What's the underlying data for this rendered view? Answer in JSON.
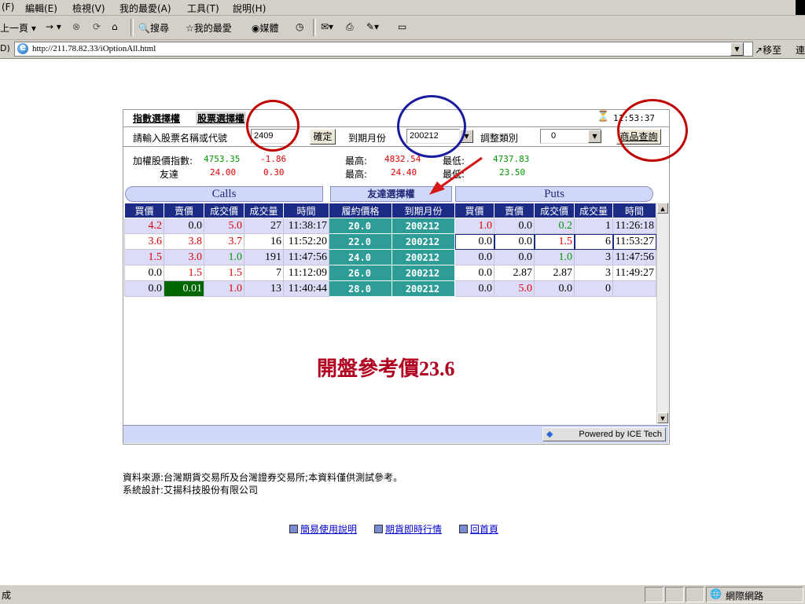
{
  "browser": {
    "menu": [
      "(F)",
      "編輯(E)",
      "檢視(V)",
      "我的最愛(A)",
      "工具(T)",
      "說明(H)"
    ],
    "toolbar": {
      "back": "上一頁",
      "search": "搜尋",
      "favorites": "我的最愛",
      "media": "媒體"
    },
    "address_label": "D)",
    "url": "http://211.78.82.33/iOptionAll.html",
    "go_label": "移至",
    "links_label": "連",
    "status_text": "成",
    "zone_label": "網際網路"
  },
  "widget": {
    "tabs": [
      "指數選擇權",
      "股票選擇權"
    ],
    "clock": "11:53:37",
    "query": {
      "label": "請輸入股票名稱或代號",
      "value": "2409",
      "confirm_button": "確定",
      "month_label": "到期月份",
      "month_value": "200212",
      "adjust_label": "調整類別",
      "adjust_value": "0",
      "lookup_button": "商品查詢"
    },
    "index_row": {
      "label": "加權股價指數:",
      "last": "4753.35",
      "change": "-1.86",
      "high_label": "最高:",
      "high": "4832.54",
      "low_label": "最低:",
      "low": "4737.83"
    },
    "stock_row": {
      "label": "友達",
      "last": "24.00",
      "change": "0.30",
      "high_label": "最高:",
      "high": "24.40",
      "low_label": "最低:",
      "low": "23.50"
    },
    "calls_title": "Calls",
    "center_title": "友達選擇權",
    "puts_title": "Puts",
    "columns": [
      "買價",
      "賣價",
      "成交價",
      "成交量",
      "時間",
      "履約價格",
      "到期月份",
      "買價",
      "賣價",
      "成交價",
      "成交量",
      "時間"
    ],
    "rows": [
      {
        "c_bid": "4.2",
        "c_ask": "0.0",
        "c_last": "5.0",
        "c_vol": "27",
        "c_time": "11:38:17",
        "strike": "20.0",
        "month": "200212",
        "p_bid": "1.0",
        "p_ask": "0.0",
        "p_last": "0.2",
        "p_vol": "1",
        "p_time": "11:26:18"
      },
      {
        "c_bid": "3.6",
        "c_ask": "3.8",
        "c_last": "3.7",
        "c_vol": "16",
        "c_time": "11:52:20",
        "strike": "22.0",
        "month": "200212",
        "p_bid": "0.0",
        "p_ask": "0.0",
        "p_last": "1.5",
        "p_vol": "6",
        "p_time": "11:53:27"
      },
      {
        "c_bid": "1.5",
        "c_ask": "3.0",
        "c_last": "1.0",
        "c_vol": "191",
        "c_time": "11:47:56",
        "strike": "24.0",
        "month": "200212",
        "p_bid": "0.0",
        "p_ask": "0.0",
        "p_last": "1.0",
        "p_vol": "3",
        "p_time": "11:47:56"
      },
      {
        "c_bid": "0.0",
        "c_ask": "1.5",
        "c_last": "1.5",
        "c_vol": "7",
        "c_time": "11:12:09",
        "strike": "26.0",
        "month": "200212",
        "p_bid": "0.0",
        "p_ask": "2.87",
        "p_last": "2.87",
        "p_vol": "3",
        "p_time": "11:49:27"
      },
      {
        "c_bid": "0.0",
        "c_ask": "0.01",
        "c_last": "1.0",
        "c_vol": "13",
        "c_time": "11:40:44",
        "strike": "28.0",
        "month": "200212",
        "p_bid": "0.0",
        "p_ask": "5.0",
        "p_last": "0.0",
        "p_vol": "0",
        "p_time": ""
      }
    ],
    "annotation": "開盤參考價23.6",
    "powered": "Powered by ICE Tech"
  },
  "footer": {
    "source": "資料來源:台灣期貨交易所及台灣證券交易所;本資料僅供測試參考。",
    "design": "系統設計:艾揚科技股份有限公司",
    "links": [
      "簡易使用說明",
      "期貨即時行情",
      "回首頁"
    ]
  },
  "colors": {
    "header_blue": "#1c2c86",
    "strike_teal": "#2f9d97",
    "row_lavender": "#dcdcf8",
    "up_red": "#e00000",
    "down_green": "#009900",
    "circle_red": "#c00000",
    "circle_blue": "#1a1aa0",
    "annotation_red": "#b00020"
  }
}
